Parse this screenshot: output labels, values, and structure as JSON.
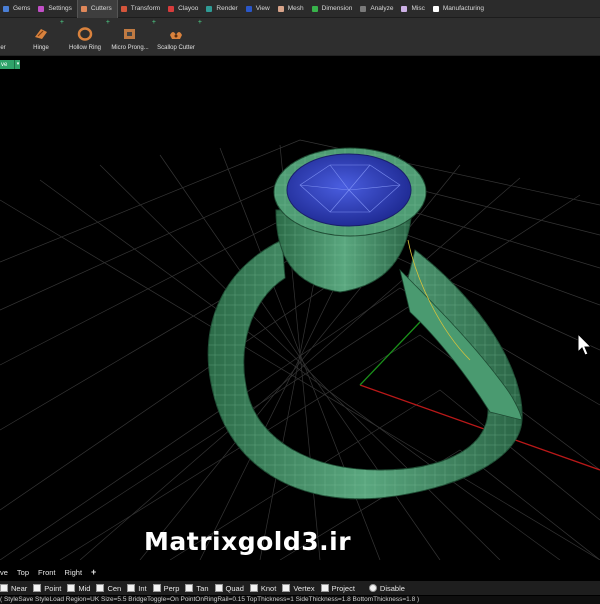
{
  "tabs": [
    {
      "label": "Gems",
      "color": "#4a7fd6"
    },
    {
      "label": "Settings",
      "color": "#c24fc7"
    },
    {
      "label": "Cutters",
      "color": "#e0885a",
      "active": true
    },
    {
      "label": "Transform",
      "color": "#d4553b"
    },
    {
      "label": "Clayoo",
      "color": "#d83c3c"
    },
    {
      "label": "Render",
      "color": "#2f9b95"
    },
    {
      "label": "View",
      "color": "#2a57c9"
    },
    {
      "label": "Mesh",
      "color": "#d8a48a"
    },
    {
      "label": "Dimension",
      "color": "#38b34b"
    },
    {
      "label": "Analyze",
      "color": "#7a7a7a"
    },
    {
      "label": "Misc",
      "color": "#cdb1e6"
    },
    {
      "label": "Manufacturing",
      "color": "#ffffff"
    }
  ],
  "tools": [
    {
      "label": "er",
      "icon": "cutter-icon"
    },
    {
      "label": "Hinge",
      "icon": "hinge-icon"
    },
    {
      "label": "Hollow Ring",
      "icon": "hollow-ring-icon"
    },
    {
      "label": "Micro Prong...",
      "icon": "micro-prong-icon"
    },
    {
      "label": "Scallop Cutter",
      "icon": "scallop-cutter-icon"
    }
  ],
  "viewport_widget": {
    "label": "ve"
  },
  "watermark": "Matrixgold3.ir",
  "view_tabs": [
    "ve",
    "Top",
    "Front",
    "Right",
    "+"
  ],
  "osnaps": [
    {
      "label": "Near",
      "kind": "checkbox"
    },
    {
      "label": "Point",
      "kind": "checkbox"
    },
    {
      "label": "Mid",
      "kind": "checkbox"
    },
    {
      "label": "Cen",
      "kind": "checkbox"
    },
    {
      "label": "Int",
      "kind": "checkbox"
    },
    {
      "label": "Perp",
      "kind": "checkbox"
    },
    {
      "label": "Tan",
      "kind": "checkbox"
    },
    {
      "label": "Quad",
      "kind": "checkbox"
    },
    {
      "label": "Knot",
      "kind": "checkbox"
    },
    {
      "label": "Vertex",
      "kind": "checkbox"
    },
    {
      "label": "Project",
      "kind": "checkbox"
    },
    {
      "label": "Disable",
      "kind": "radio"
    }
  ],
  "command_line": "( StyleSave  StyleLoad  Region=UK  Size=5.5  BridgeToggle=On  PointOnRingRail=0.15  TopThickness=1  SideThickness=1.8  BottomThickness=1.8 )",
  "colors": {
    "ring": "#3f8862",
    "gem": "#2e3fb8",
    "grid": "#3a3a3a",
    "axis_x": "#b81818",
    "axis_y": "#1a8f1a"
  }
}
